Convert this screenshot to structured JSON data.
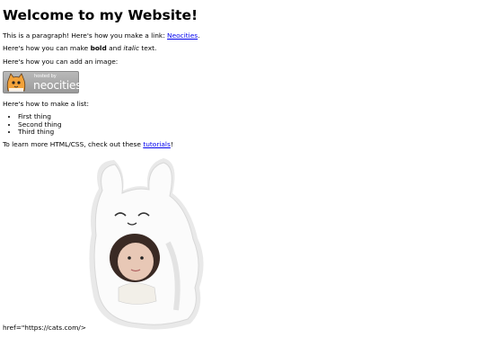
{
  "page": {
    "title": "Welcome to my Website!",
    "link_intro": "This is a paragraph! Here's how you make a link: ",
    "link_text": "Neocities",
    "link_end": ".",
    "format_a": "Here's how you can make ",
    "format_bold": "bold",
    "format_b": " and ",
    "format_italic": "italic",
    "format_c": " text.",
    "image_intro": "Here's how you can add an image:",
    "badge_small": "hosted by",
    "badge_large": "neocities",
    "list_intro": "Here's how to make a list:",
    "list_items": [
      "First thing",
      "Second thing",
      "Third thing"
    ],
    "learn_a": "To learn more HTML/CSS, check out these ",
    "learn_link": "tutorials",
    "learn_end": "!",
    "stray_text": "href=\"https://cats.com/>"
  },
  "colors": {
    "link": "#0000ee",
    "background": "#ffffff"
  },
  "icons": {
    "badge_logo": "cat-mascot-icon",
    "image": "plush-bunny-hat-photo"
  }
}
